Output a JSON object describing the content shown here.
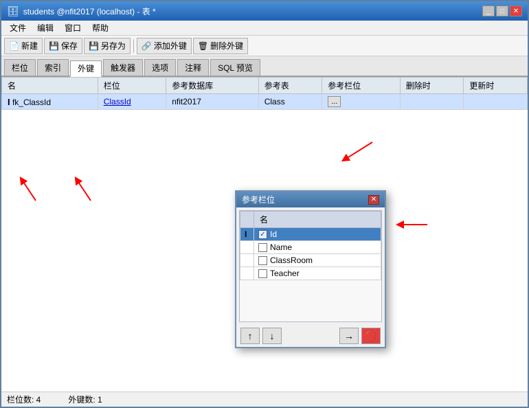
{
  "window": {
    "title": "students @nfit2017 (localhost) - 表 *",
    "controls": [
      "_",
      "□",
      "✕"
    ]
  },
  "menubar": {
    "items": [
      "文件",
      "编辑",
      "窗口",
      "帮助"
    ]
  },
  "toolbar": {
    "buttons": [
      {
        "label": "新建",
        "icon": "📄"
      },
      {
        "label": "保存",
        "icon": "💾"
      },
      {
        "label": "另存为",
        "icon": "💾"
      },
      {
        "label": "添加外键",
        "icon": "🔗"
      },
      {
        "label": "删除外键",
        "icon": "🗑"
      }
    ]
  },
  "tabs": {
    "items": [
      "栏位",
      "索引",
      "外键",
      "触发器",
      "选项",
      "注释",
      "SQL 预览"
    ],
    "active": 2
  },
  "table": {
    "columns": [
      "名",
      "栏位",
      "参考数据库",
      "参考表",
      "参考栏位",
      "删除时",
      "更新时"
    ],
    "rows": [
      {
        "cursor": "I",
        "name": "fk_ClassId",
        "field": "ClassId",
        "refdb": "nfit2017",
        "reftable": "Class",
        "refcol": "...",
        "deltime": "",
        "updtime": ""
      }
    ]
  },
  "dialog": {
    "title": "参考栏位",
    "column_header": "名",
    "rows": [
      {
        "name": "Id",
        "checked": true,
        "selected": true
      },
      {
        "name": "Name",
        "checked": false,
        "selected": false
      },
      {
        "name": "ClassRoom",
        "checked": false,
        "selected": false
      },
      {
        "name": "Teacher",
        "checked": false,
        "selected": false
      }
    ],
    "footer_buttons_left": [
      "↑",
      "↓"
    ],
    "footer_buttons_right": [
      "→",
      "🚫"
    ]
  },
  "statusbar": {
    "col_count": "栏位数: 4",
    "fk_count": "外键数: 1"
  },
  "arrows": [
    {
      "id": "arrow1",
      "label": "↖"
    },
    {
      "id": "arrow2",
      "label": "↖"
    },
    {
      "id": "arrow3",
      "label": "↙"
    }
  ]
}
